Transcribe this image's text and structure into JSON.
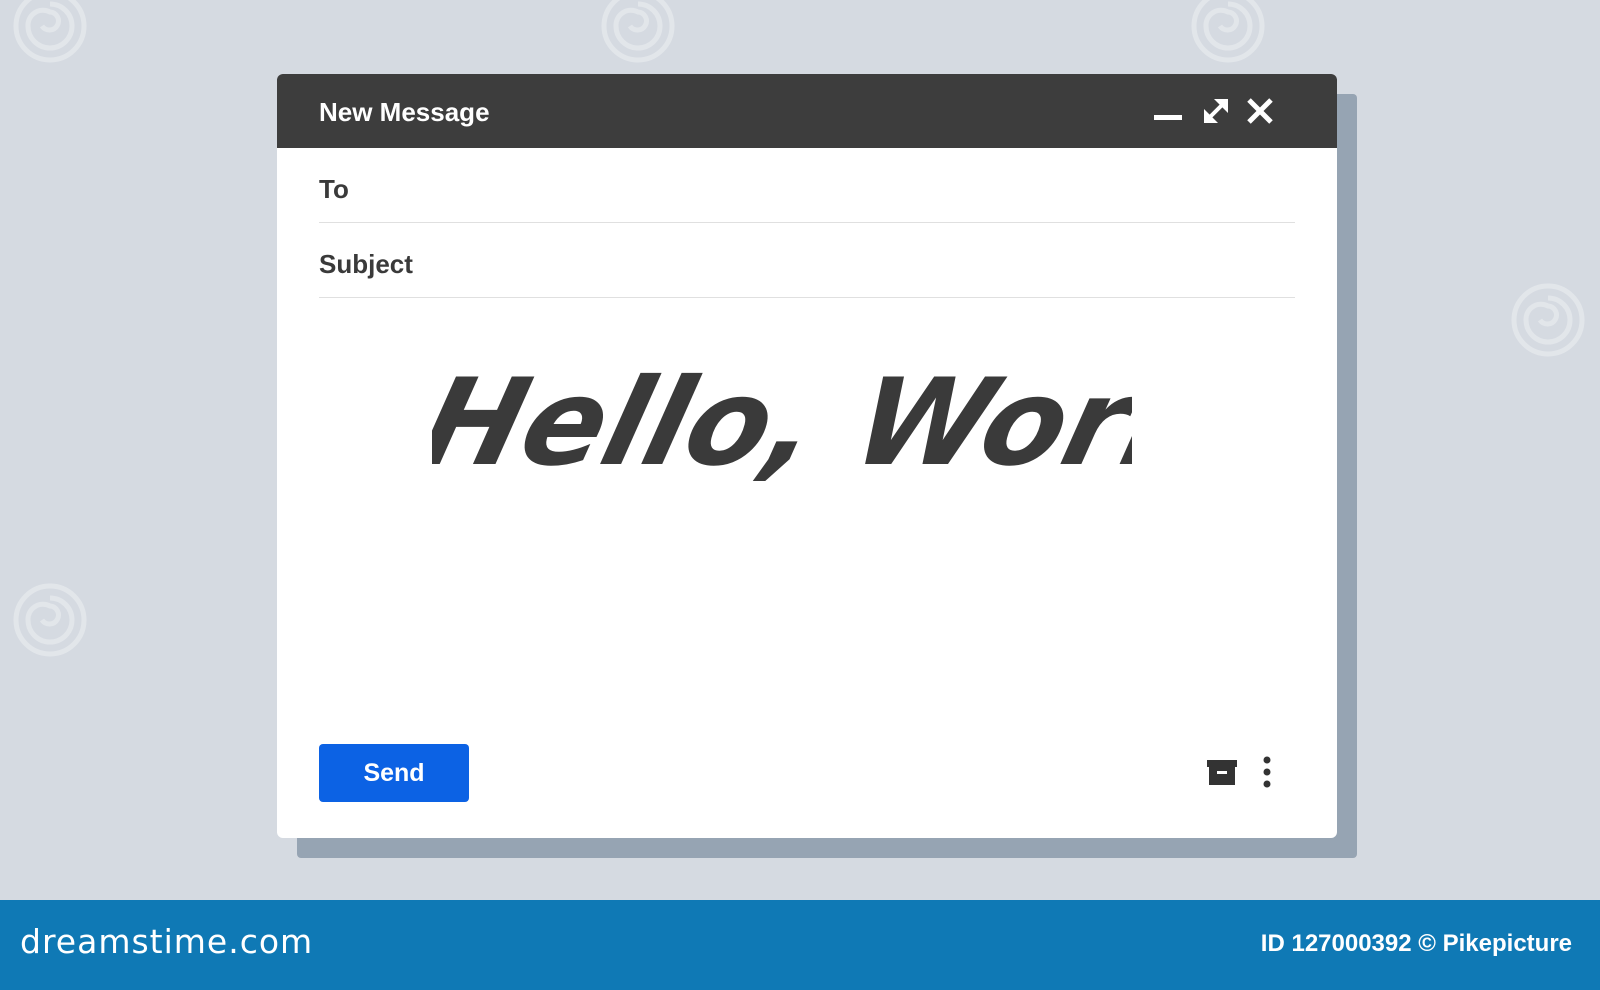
{
  "window": {
    "title": "New Message",
    "controls": {
      "minimize_icon": "minimize-icon",
      "expand_icon": "expand-icon",
      "close_icon": "close-icon"
    }
  },
  "fields": {
    "to": {
      "label": "To",
      "value": ""
    },
    "subject": {
      "label": "Subject",
      "value": ""
    }
  },
  "message": {
    "body_text": "Hello, World!"
  },
  "actions": {
    "send_label": "Send",
    "archive_icon": "archive-icon",
    "more_icon": "more-vertical-icon",
    "accent_color": "#0c62e4"
  },
  "watermark": {
    "brand": "dreamstime.com",
    "credit": "ID 127000392 © Pikepicture",
    "footer_color": "#0f79b5"
  }
}
